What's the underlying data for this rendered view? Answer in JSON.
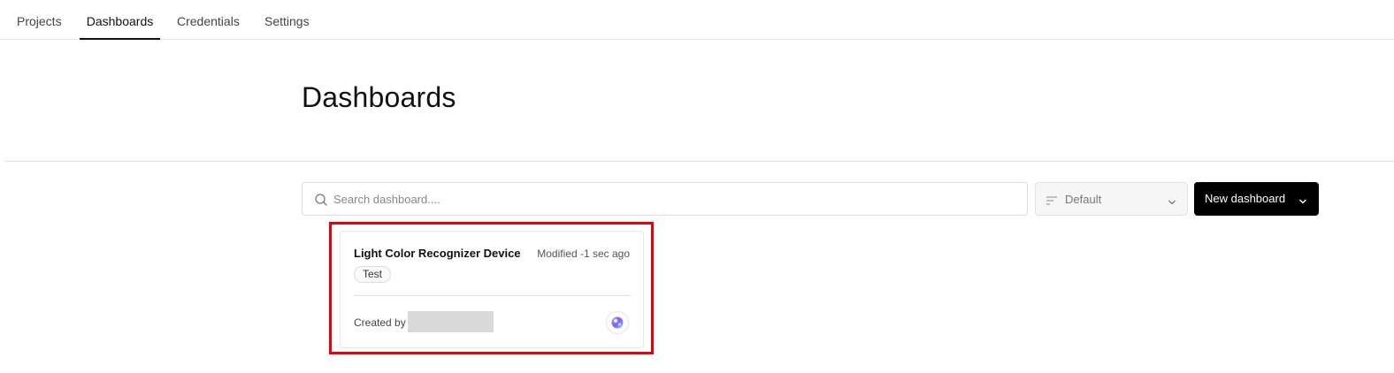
{
  "nav": {
    "tabs": [
      {
        "label": "Projects",
        "active": false
      },
      {
        "label": "Dashboards",
        "active": true
      },
      {
        "label": "Credentials",
        "active": false
      },
      {
        "label": "Settings",
        "active": false
      }
    ]
  },
  "page": {
    "title": "Dashboards"
  },
  "toolbar": {
    "search_placeholder": "Search dashboard....",
    "search_value": "",
    "sort_value": "Default",
    "new_button_label": "New dashboard"
  },
  "dashboards": [
    {
      "title": "Light Color Recognizer Device",
      "modified": "Modified -1 sec ago",
      "tag": "Test",
      "created_by_label": "Created by"
    }
  ],
  "colors": {
    "highlight": "#e8000b",
    "primary_button": "#000000"
  },
  "icons": {
    "search": "search-icon",
    "sort": "sort-lines-icon",
    "chevron": "chevron-down-icon",
    "avatar": "user-avatar-icon"
  }
}
